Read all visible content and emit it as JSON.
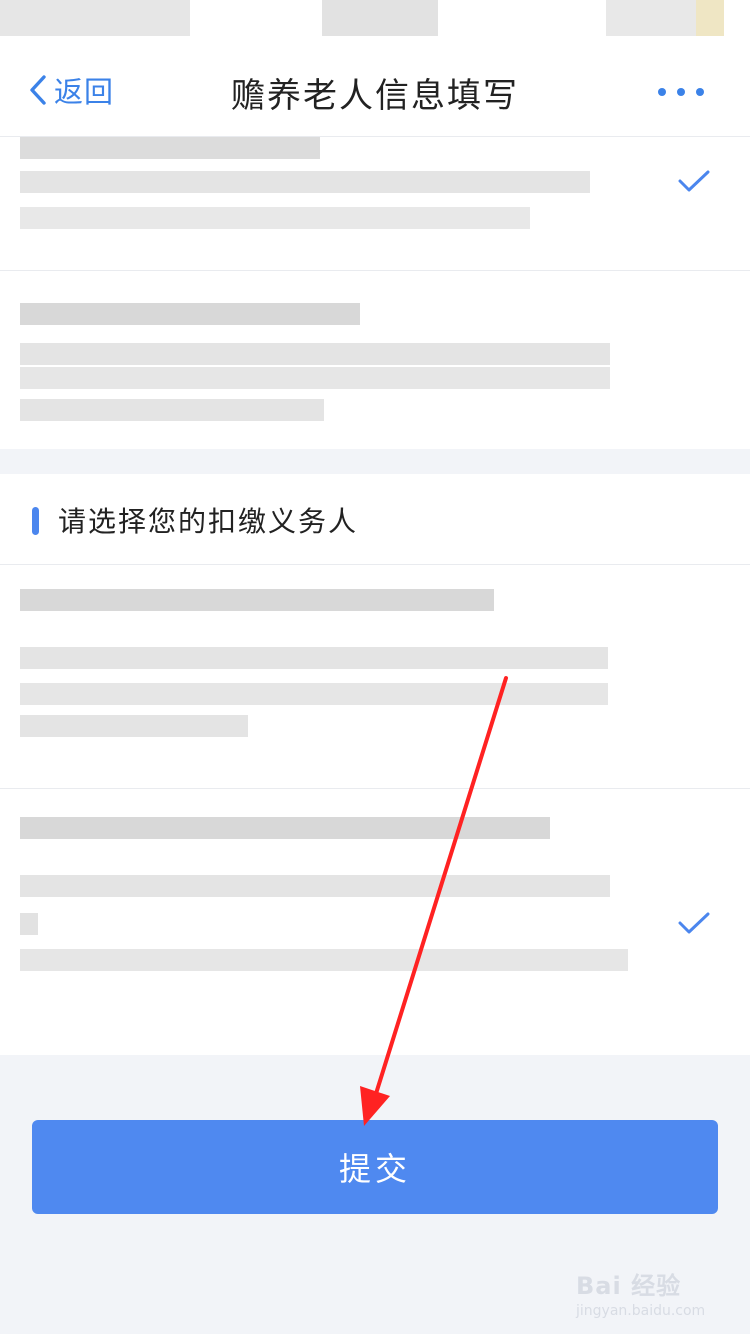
{
  "nav": {
    "back_label": "返回",
    "title": "赡养老人信息填写"
  },
  "section": {
    "title": "请选择您的扣缴义务人"
  },
  "dependents_options": [
    {
      "label": "",
      "selected": true
    },
    {
      "label": "",
      "selected": false
    }
  ],
  "withholding_agent_options": [
    {
      "label": "",
      "selected": false
    },
    {
      "label": "",
      "selected": true
    }
  ],
  "submit_label": "提交",
  "watermark": {
    "logo": "Bai 经验",
    "url": "jingyan.baidu.com"
  },
  "colors": {
    "accent": "#4f89f0",
    "link": "#3b82e8",
    "annotation_arrow": "#ff2222",
    "page_background": "#f2f4f8"
  }
}
